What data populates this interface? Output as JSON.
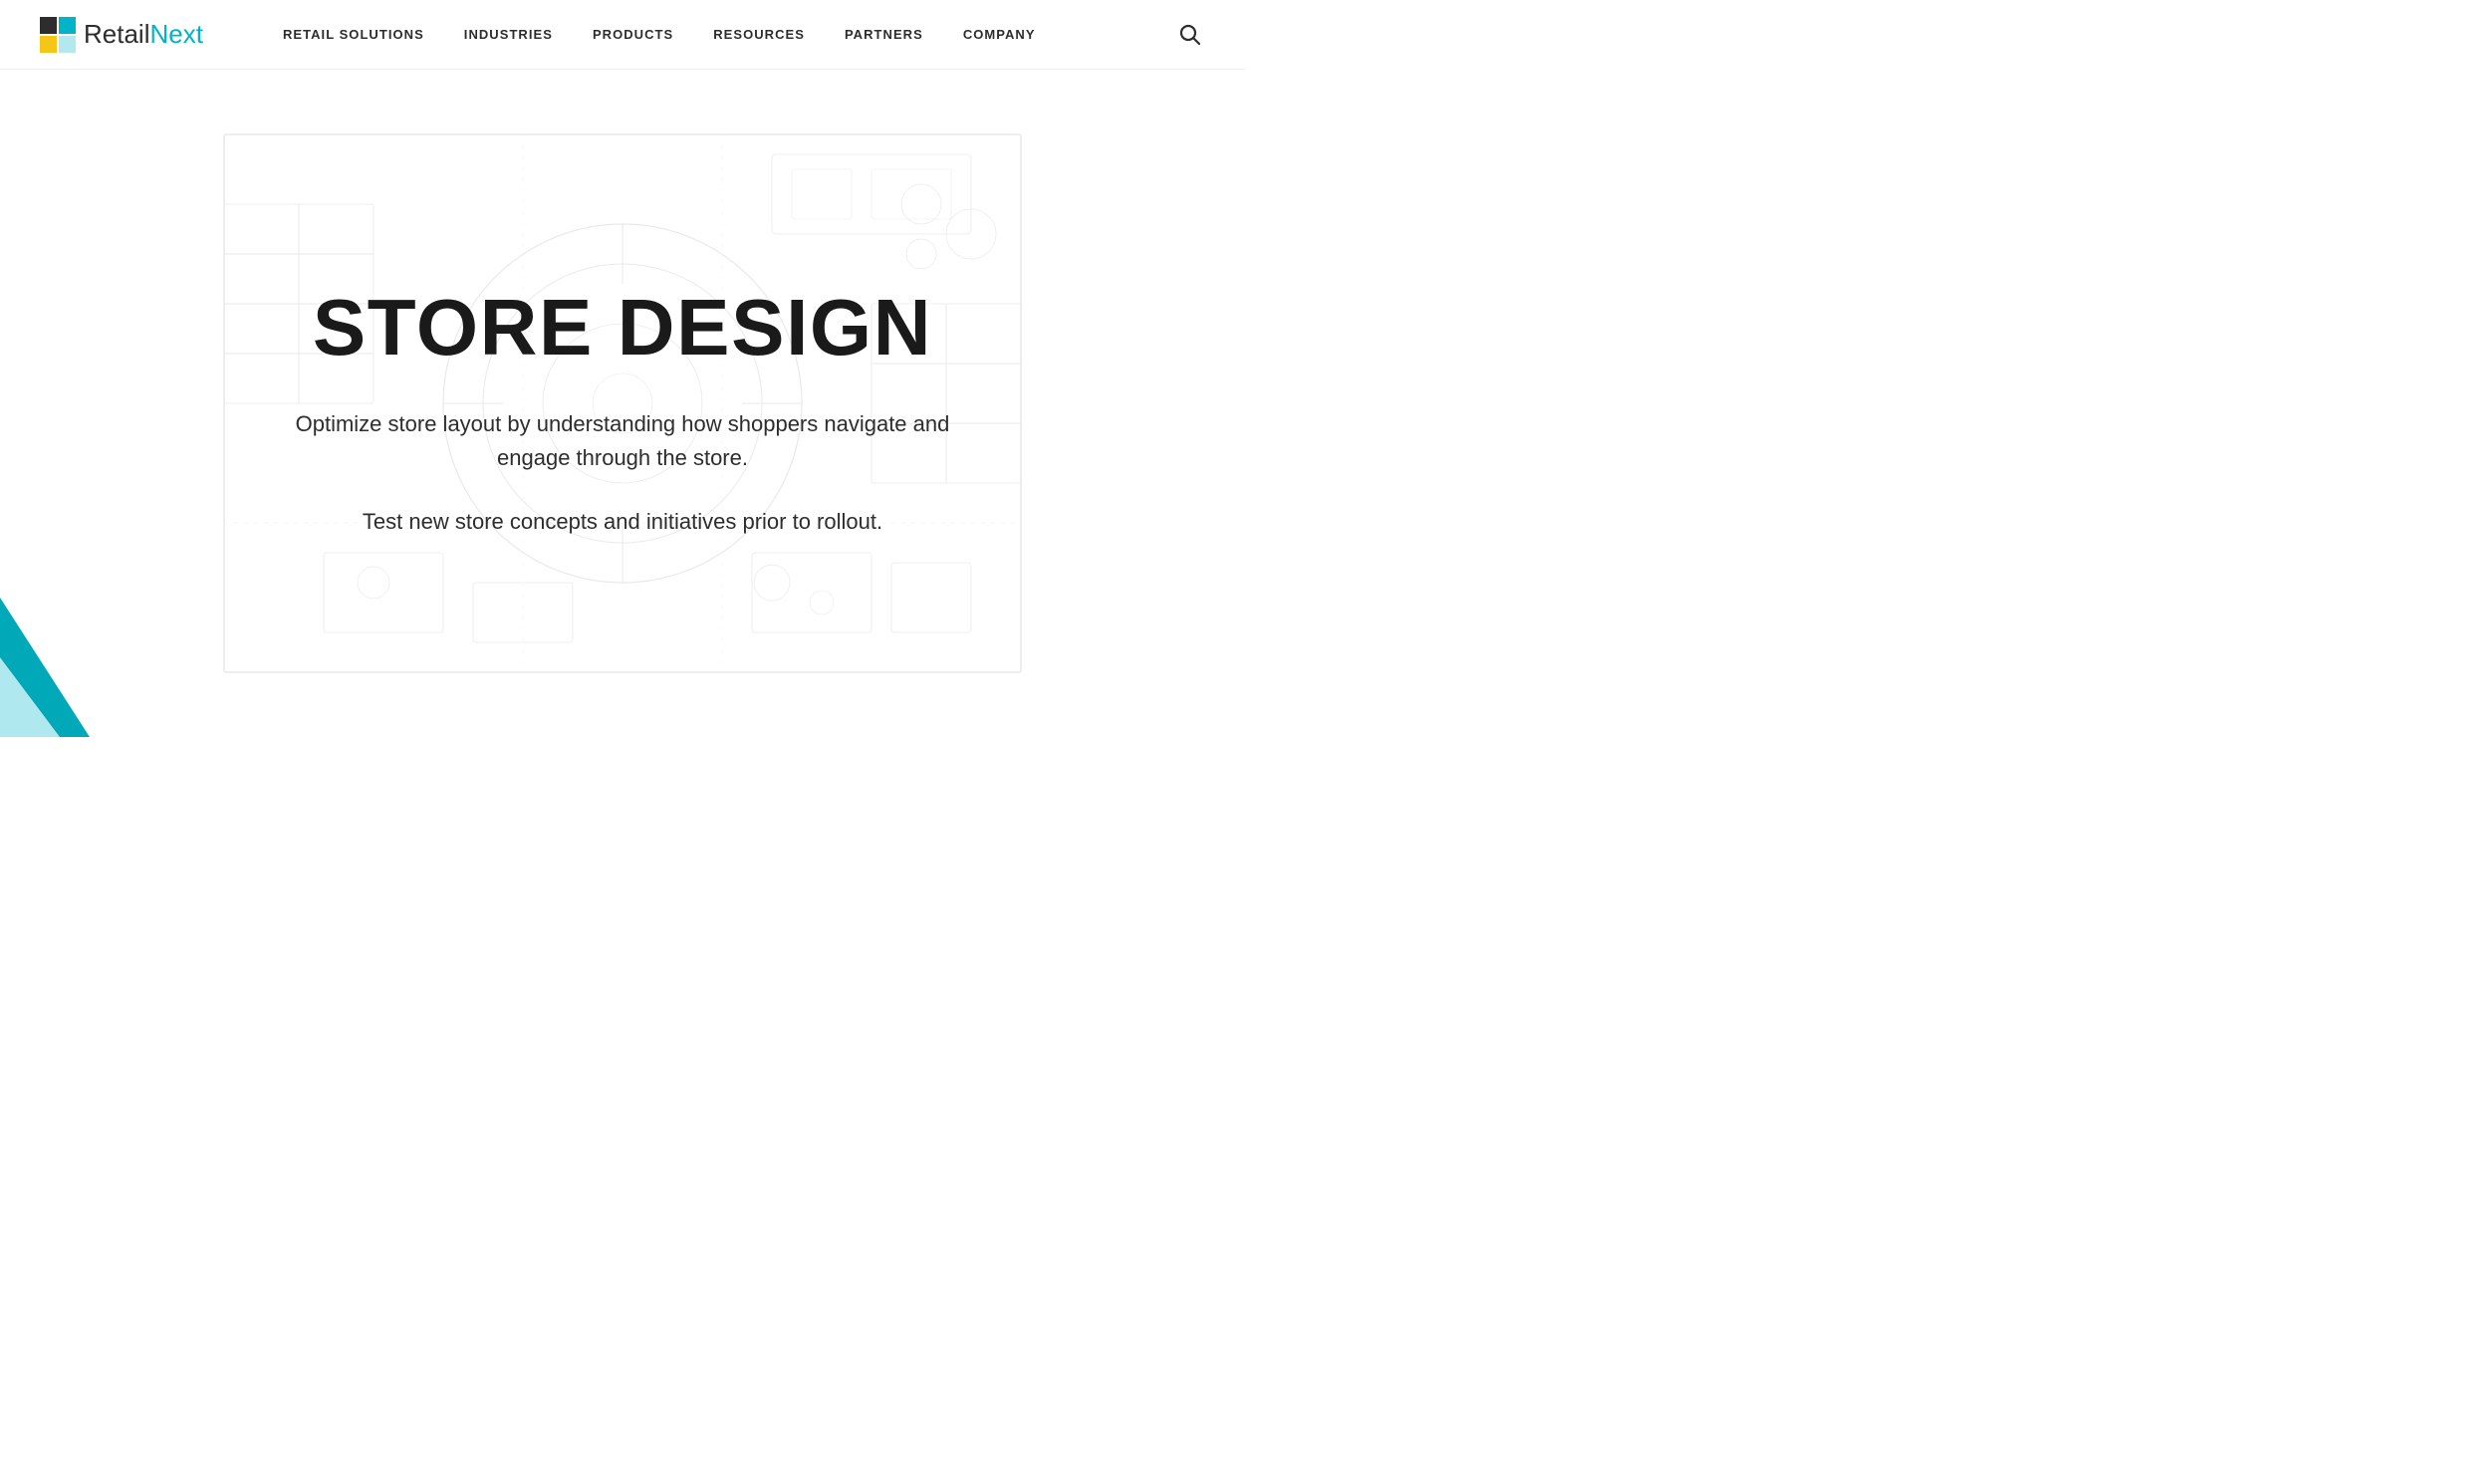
{
  "brand": {
    "name_part1": "Retail",
    "name_part2": "Next"
  },
  "nav": {
    "items": [
      {
        "label": "RETAIL SOLUTIONS",
        "id": "retail-solutions"
      },
      {
        "label": "INDUSTRIES",
        "id": "industries"
      },
      {
        "label": "PRODUCTS",
        "id": "products"
      },
      {
        "label": "RESOURCES",
        "id": "resources"
      },
      {
        "label": "PARTNERS",
        "id": "partners"
      },
      {
        "label": "COMPANY",
        "id": "company"
      }
    ]
  },
  "hero": {
    "title": "STORE DESIGN",
    "description1": "Optimize store layout by understanding how shoppers navigate and engage through the store.",
    "description2": "Test new store concepts and initiatives prior to rollout."
  },
  "colors": {
    "teal": "#00b4c8",
    "teal_light": "#b3e8ee",
    "dark": "#1a1a1a"
  }
}
